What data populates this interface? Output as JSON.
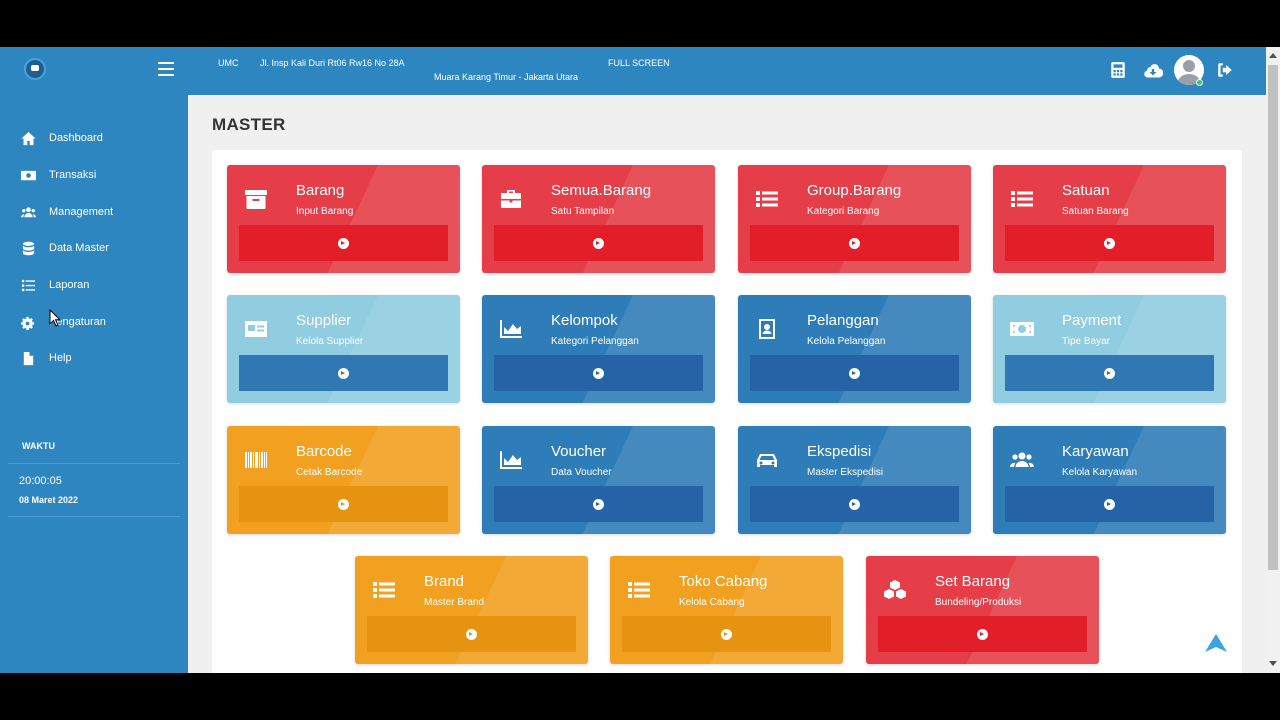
{
  "header": {
    "company": "UMC",
    "address_line1": "Jl. Insp Kali Duri Rt06 Rw16 No 28A",
    "address_line2": "Muara Karang Timur - Jakarta Utara",
    "fullscreen_label": "FULL SCREEN",
    "icons": [
      "calculator-icon",
      "cloud-download-icon",
      "user-avatar",
      "sign-out-icon"
    ]
  },
  "sidebar": {
    "items": [
      {
        "label": "Dashboard",
        "icon": "home-icon"
      },
      {
        "label": "Transaksi",
        "icon": "money-icon"
      },
      {
        "label": "Management",
        "icon": "users-icon"
      },
      {
        "label": "Data Master",
        "icon": "database-icon"
      },
      {
        "label": "Laporan",
        "icon": "list-icon"
      },
      {
        "label": "Pengaturan",
        "icon": "cogs-icon"
      },
      {
        "label": "Help",
        "icon": "file-icon"
      }
    ],
    "section_label": "WAKTU",
    "time": "20:00:05",
    "date": "08 Maret 2022"
  },
  "main": {
    "title": "MASTER",
    "cards": [
      {
        "title": "Barang",
        "subtitle": "Input Barang",
        "color": "red",
        "icon": "archive-icon"
      },
      {
        "title": "Semua.Barang",
        "subtitle": "Satu Tampilan",
        "color": "red",
        "icon": "briefcase-icon"
      },
      {
        "title": "Group.Barang",
        "subtitle": "Kategori Barang",
        "color": "red",
        "icon": "list-icon"
      },
      {
        "title": "Satuan",
        "subtitle": "Satuan Barang",
        "color": "red",
        "icon": "list-icon"
      },
      {
        "title": "Supplier",
        "subtitle": "Kelola Supplier",
        "color": "light-blue",
        "icon": "id-card-icon"
      },
      {
        "title": "Kelompok",
        "subtitle": "Kategori Pelanggan",
        "color": "blue",
        "icon": "area-chart-icon"
      },
      {
        "title": "Pelanggan",
        "subtitle": "Kelola Pelanggan",
        "color": "blue",
        "icon": "address-book-icon"
      },
      {
        "title": "Payment",
        "subtitle": "Tipe Bayar",
        "color": "light-blue",
        "icon": "money-bill-icon"
      },
      {
        "title": "Barcode",
        "subtitle": "Cetak Barcode",
        "color": "orange",
        "icon": "barcode-icon"
      },
      {
        "title": "Voucher",
        "subtitle": "Data Voucher",
        "color": "blue",
        "icon": "area-chart-icon"
      },
      {
        "title": "Ekspedisi",
        "subtitle": "Master Ekspedisi",
        "color": "blue",
        "icon": "car-icon"
      },
      {
        "title": "Karyawan",
        "subtitle": "Kelola Karyawan",
        "color": "blue",
        "icon": "users-icon"
      },
      {
        "title": "Brand",
        "subtitle": "Master Brand",
        "color": "orange",
        "icon": "list-icon"
      },
      {
        "title": "Toko Cabang",
        "subtitle": "Kelola Cabang",
        "color": "orange",
        "icon": "list-icon"
      },
      {
        "title": "Set Barang",
        "subtitle": "Bundeling/Produksi",
        "color": "red",
        "icon": "cubes-icon"
      }
    ]
  },
  "colors": {
    "primary": "#2e86c1",
    "red": "#e53e48",
    "light_blue": "#90cde0",
    "blue": "#2f7db8",
    "orange": "#f2a01f"
  }
}
